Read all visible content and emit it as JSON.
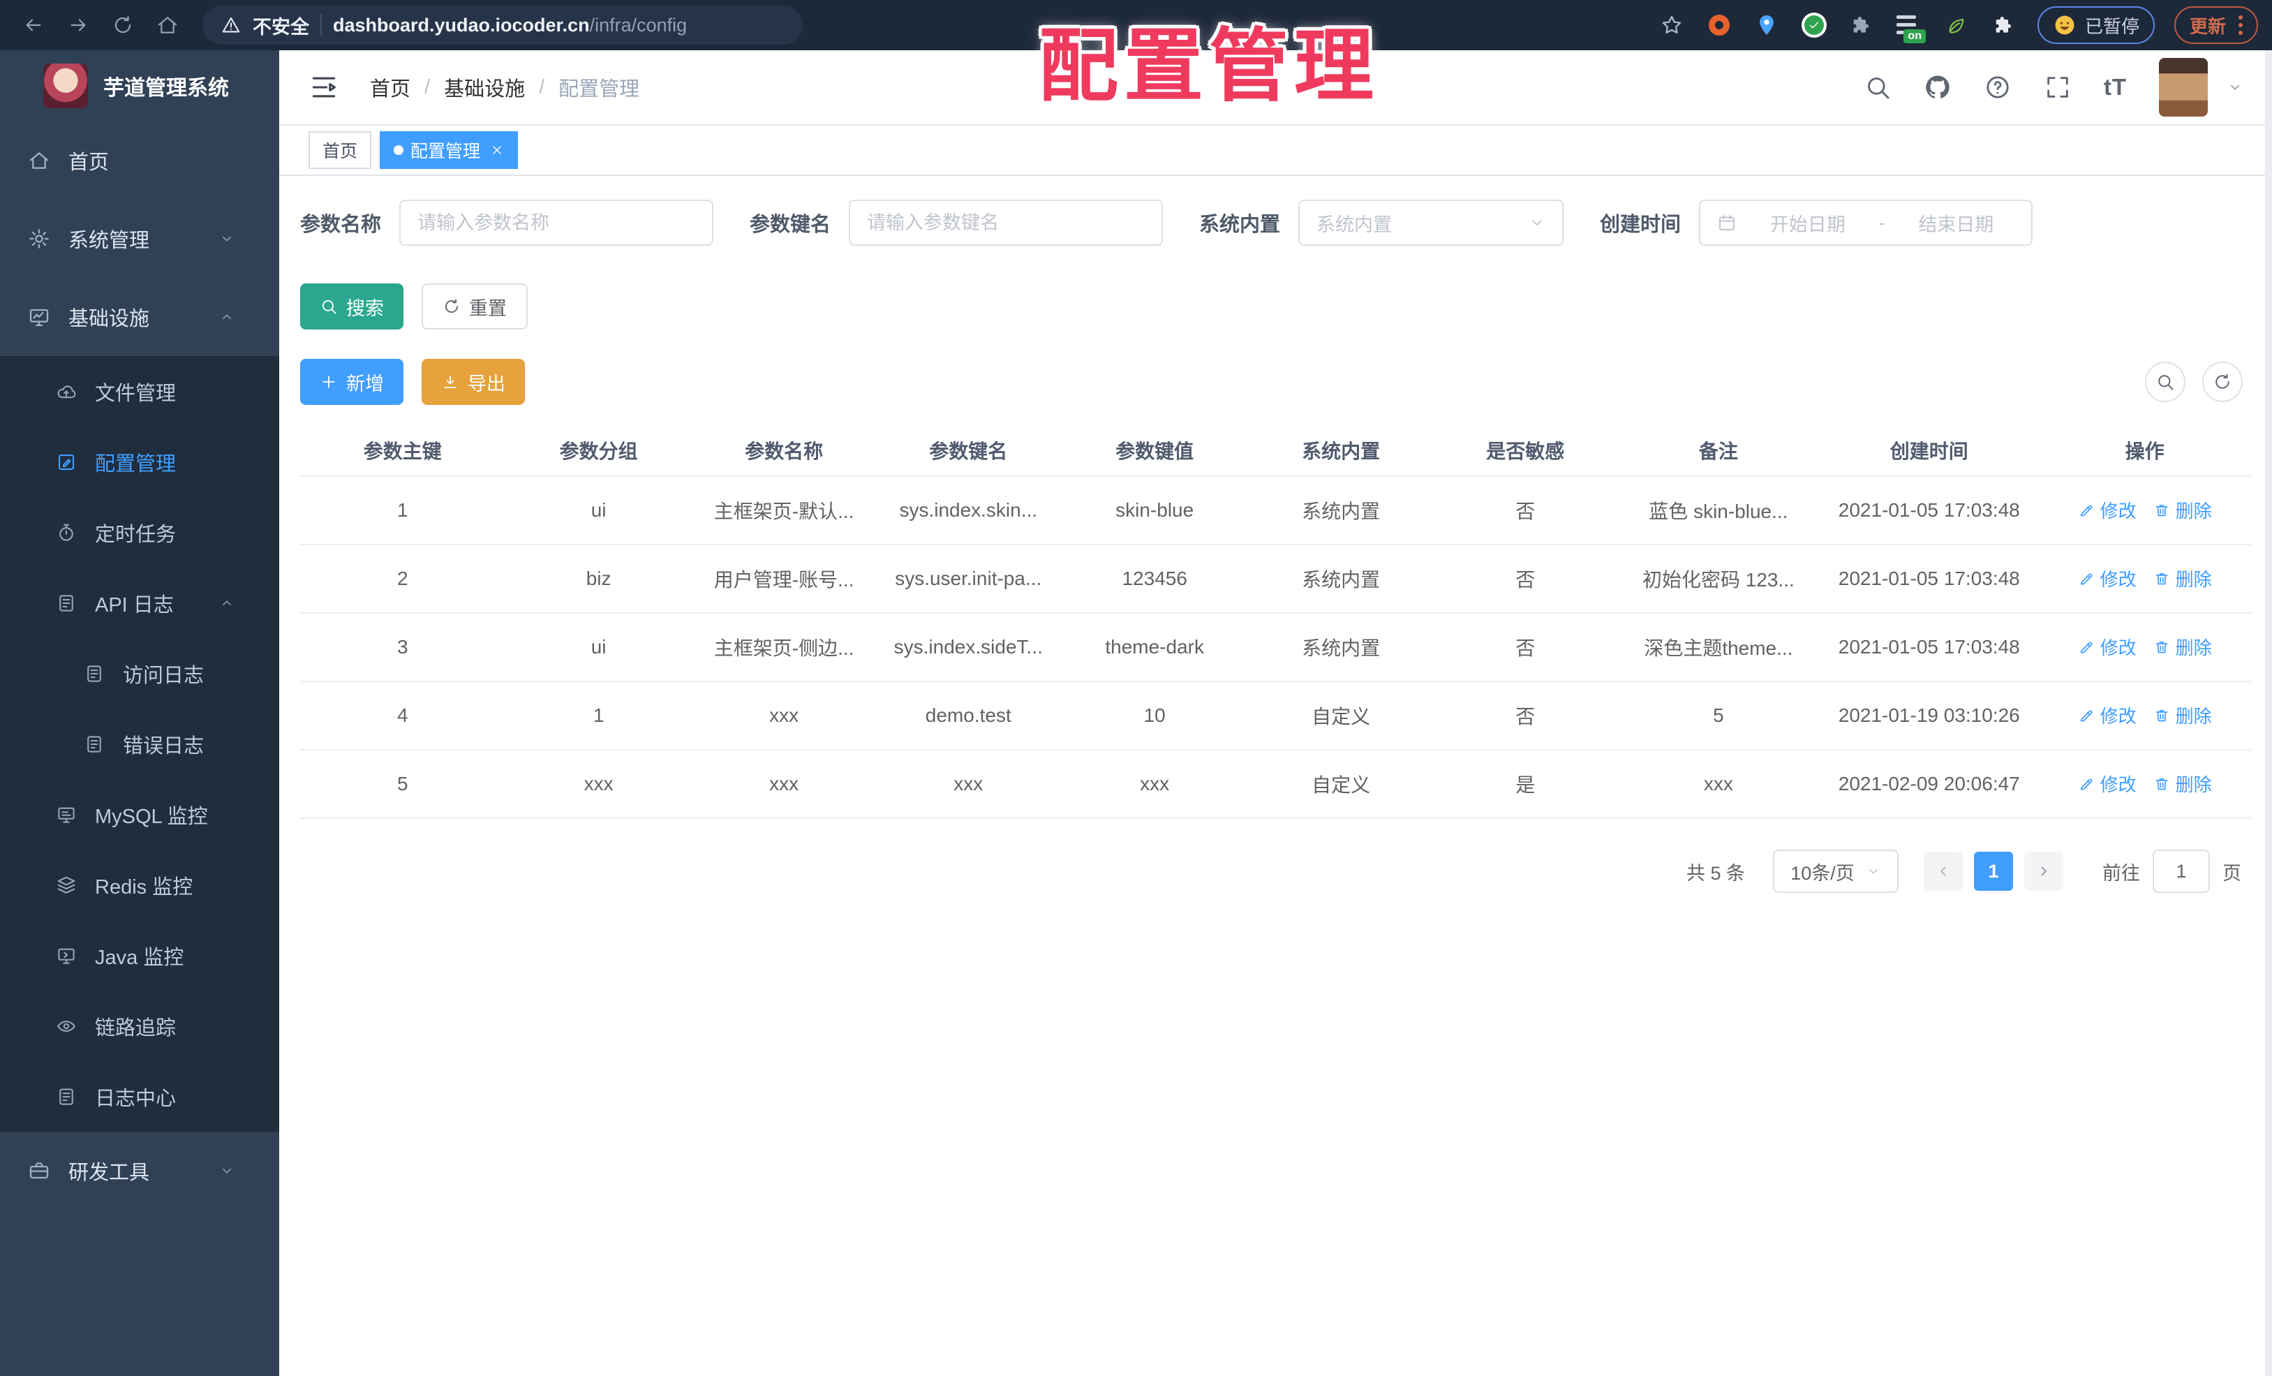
{
  "browser": {
    "security_label": "不安全",
    "url_host": "dashboard.yudao.iocoder.cn",
    "url_path": "/infra/config",
    "paused_label": "已暂停",
    "update_label": "更新",
    "ext_on_badge": "on"
  },
  "overlay_title": "配置管理",
  "sidebar": {
    "app_title": "芋道管理系统",
    "menu": [
      {
        "label": "首页",
        "icon": "home"
      },
      {
        "label": "系统管理",
        "icon": "gear",
        "chevron": "down"
      },
      {
        "label": "基础设施",
        "icon": "monitor",
        "chevron": "up",
        "children": [
          {
            "label": "文件管理",
            "icon": "cloud"
          },
          {
            "label": "配置管理",
            "icon": "edit",
            "active": true
          },
          {
            "label": "定时任务",
            "icon": "timer"
          },
          {
            "label": "API 日志",
            "icon": "log",
            "chevron": "up",
            "children": [
              {
                "label": "访问日志",
                "icon": "log"
              },
              {
                "label": "错误日志",
                "icon": "log"
              }
            ]
          },
          {
            "label": "MySQL 监控",
            "icon": "mysql"
          },
          {
            "label": "Redis 监控",
            "icon": "redis"
          },
          {
            "label": "Java 监控",
            "icon": "java"
          },
          {
            "label": "链路追踪",
            "icon": "eye"
          },
          {
            "label": "日志中心",
            "icon": "log"
          }
        ]
      },
      {
        "label": "研发工具",
        "icon": "tools",
        "chevron": "down"
      }
    ]
  },
  "header": {
    "breadcrumb": [
      "首页",
      "基础设施",
      "配置管理"
    ],
    "breadcrumb_separator": "/",
    "font_icon_label": "tT"
  },
  "tags": [
    {
      "label": "首页",
      "active": false,
      "closable": false
    },
    {
      "label": "配置管理",
      "active": true,
      "closable": true
    }
  ],
  "filters": {
    "name_label": "参数名称",
    "name_placeholder": "请输入参数名称",
    "key_label": "参数键名",
    "key_placeholder": "请输入参数键名",
    "type_label": "系统内置",
    "type_placeholder": "系统内置",
    "date_label": "创建时间",
    "date_start": "开始日期",
    "date_separator": "-",
    "date_end": "结束日期",
    "search": "搜索",
    "reset": "重置"
  },
  "toolbar": {
    "add": "新增",
    "export": "导出"
  },
  "table": {
    "columns": [
      "参数主键",
      "参数分组",
      "参数名称",
      "参数键名",
      "参数键值",
      "系统内置",
      "是否敏感",
      "备注",
      "创建时间",
      "操作"
    ],
    "edit_label": "修改",
    "delete_label": "删除",
    "rows": [
      {
        "cells": [
          "1",
          "ui",
          "主框架页-默认...",
          "sys.index.skin...",
          "skin-blue",
          "系统内置",
          "否",
          "蓝色 skin-blue...",
          "2021-01-05 17:03:48"
        ]
      },
      {
        "cells": [
          "2",
          "biz",
          "用户管理-账号...",
          "sys.user.init-pa...",
          "123456",
          "系统内置",
          "否",
          "初始化密码 123...",
          "2021-01-05 17:03:48"
        ]
      },
      {
        "cells": [
          "3",
          "ui",
          "主框架页-侧边...",
          "sys.index.sideT...",
          "theme-dark",
          "系统内置",
          "否",
          "深色主题theme...",
          "2021-01-05 17:03:48"
        ]
      },
      {
        "cells": [
          "4",
          "1",
          "xxx",
          "demo.test",
          "10",
          "自定义",
          "否",
          "5",
          "2021-01-19 03:10:26"
        ]
      },
      {
        "cells": [
          "5",
          "xxx",
          "xxx",
          "xxx",
          "xxx",
          "自定义",
          "是",
          "xxx",
          "2021-02-09 20:06:47"
        ]
      }
    ]
  },
  "pagination": {
    "total": "共 5 条",
    "page_size": "10条/页",
    "current_page": "1",
    "goto_label": "前往",
    "goto_value": "1",
    "page_unit": "页"
  },
  "colors": {
    "accent": "#409eff",
    "teal": "#2aa78e",
    "warning": "#e6a23c",
    "overlay_red": "#ef3a5e",
    "sidebar": "#304156",
    "submenu": "#1f2d3d"
  }
}
